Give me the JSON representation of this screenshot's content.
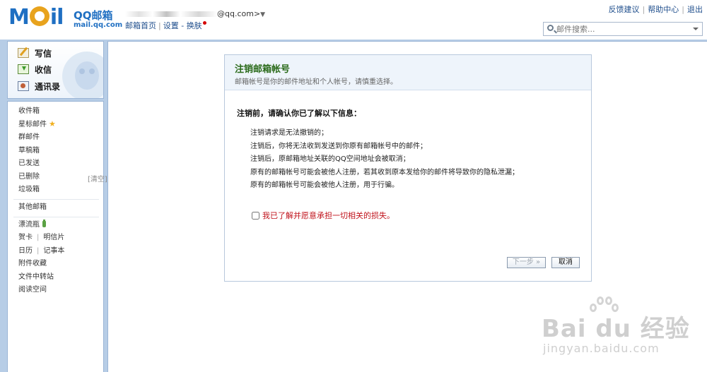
{
  "header": {
    "logo_mail": "MOil",
    "logo_brand": "QQ邮箱",
    "logo_domain": "mail.qq.com",
    "user_email_suffix": "@qq.com>",
    "user_dropdown_glyph": "▼",
    "links": {
      "home": "邮箱首页",
      "settings": "设置",
      "skin": "换肤"
    },
    "top_right": {
      "feedback": "反馈建议",
      "help": "帮助中心",
      "logout": "退出"
    },
    "search_placeholder": "邮件搜索..."
  },
  "sidebar": {
    "actions": {
      "write": "写信",
      "inbox": "收信",
      "contacts": "通讯录"
    },
    "folders": {
      "inbox": "收件箱",
      "starred": "星标邮件",
      "group": "群邮件",
      "drafts": "草稿箱",
      "sent": "已发送",
      "deleted": "已删除",
      "clear": "[清空]",
      "spam": "垃圾箱",
      "other": "其他邮箱",
      "drift_bottle": "漂流瓶",
      "greeting_card": "贺卡",
      "postcard": "明信片",
      "calendar": "日历",
      "notepad": "记事本",
      "attachments": "附件收藏",
      "file_transfer": "文件中转站",
      "reading_space": "阅读空间"
    }
  },
  "dialog": {
    "title": "注销邮箱帐号",
    "subtitle": "邮箱帐号是你的邮件地址和个人帐号，请慎重选择。",
    "confirm_heading": "注销前，请确认你已了解以下信息：",
    "info_lines": [
      "注销请求是无法撤销的；",
      "注销后，你将无法收到发送到你原有邮箱帐号中的邮件；",
      "注销后，原邮箱地址关联的QQ空间地址会被取消；",
      "原有的邮箱帐号可能会被他人注册，若其收到原本发给你的邮件将导致你的隐私泄漏；",
      "原有的邮箱帐号可能会被他人注册，用于行骗。"
    ],
    "agree_label": "我已了解并愿意承担一切相关的损失。",
    "agree_checked": false,
    "next_label": "下一步 »",
    "cancel_label": "取消"
  },
  "watermark": {
    "text": "Bai du 经验",
    "url": "jingyan.baidu.com"
  }
}
